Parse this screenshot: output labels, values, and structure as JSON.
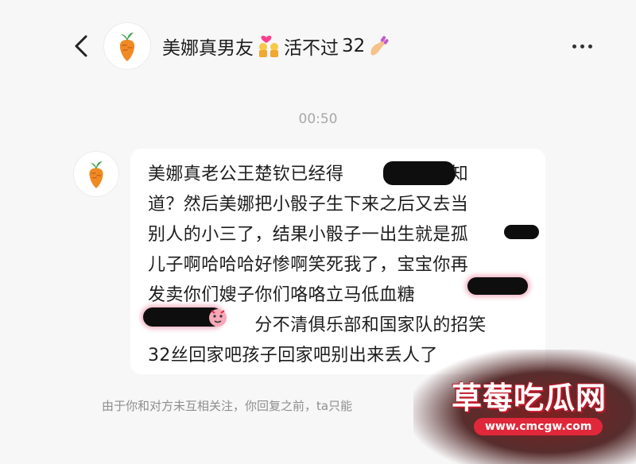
{
  "header": {
    "title_part1": "美娜真男友",
    "title_part2": "活不过",
    "title_part3": "32",
    "back_icon": "chevron-left-icon",
    "more_icon": "more-dots-icon",
    "avatar_icon": "carrot-icon"
  },
  "chat": {
    "timestamp": "00:50",
    "message": {
      "avatar_icon": "carrot-icon",
      "lines": [
        "美娜真老公王楚钦已经得　　　　你不知",
        "道？然后美娜把小骰子生下来之后又去当",
        "别人的小三了，结果小骰子一出生就是孤",
        "儿子啊哈哈哈好惨啊笑死我了，宝宝你再",
        "发卖你们嫂子你们咯咯立马低血糖　　　",
        "　　　　　　分不清俱乐部和国家队的招笑",
        "32丝回家吧孩子回家吧别出来丢人了"
      ]
    },
    "notice": "由于你和对方未互相关注，你回复之前，ta只能"
  },
  "watermark": {
    "text": "草莓吃瓜网",
    "url": "www.cmcgw.com"
  },
  "colors": {
    "background": "#f7f7f8",
    "bubble": "#ffffff",
    "timestamp": "#a8a8a8",
    "notice": "#8e8e8e",
    "watermark_red": "#e0283a"
  }
}
